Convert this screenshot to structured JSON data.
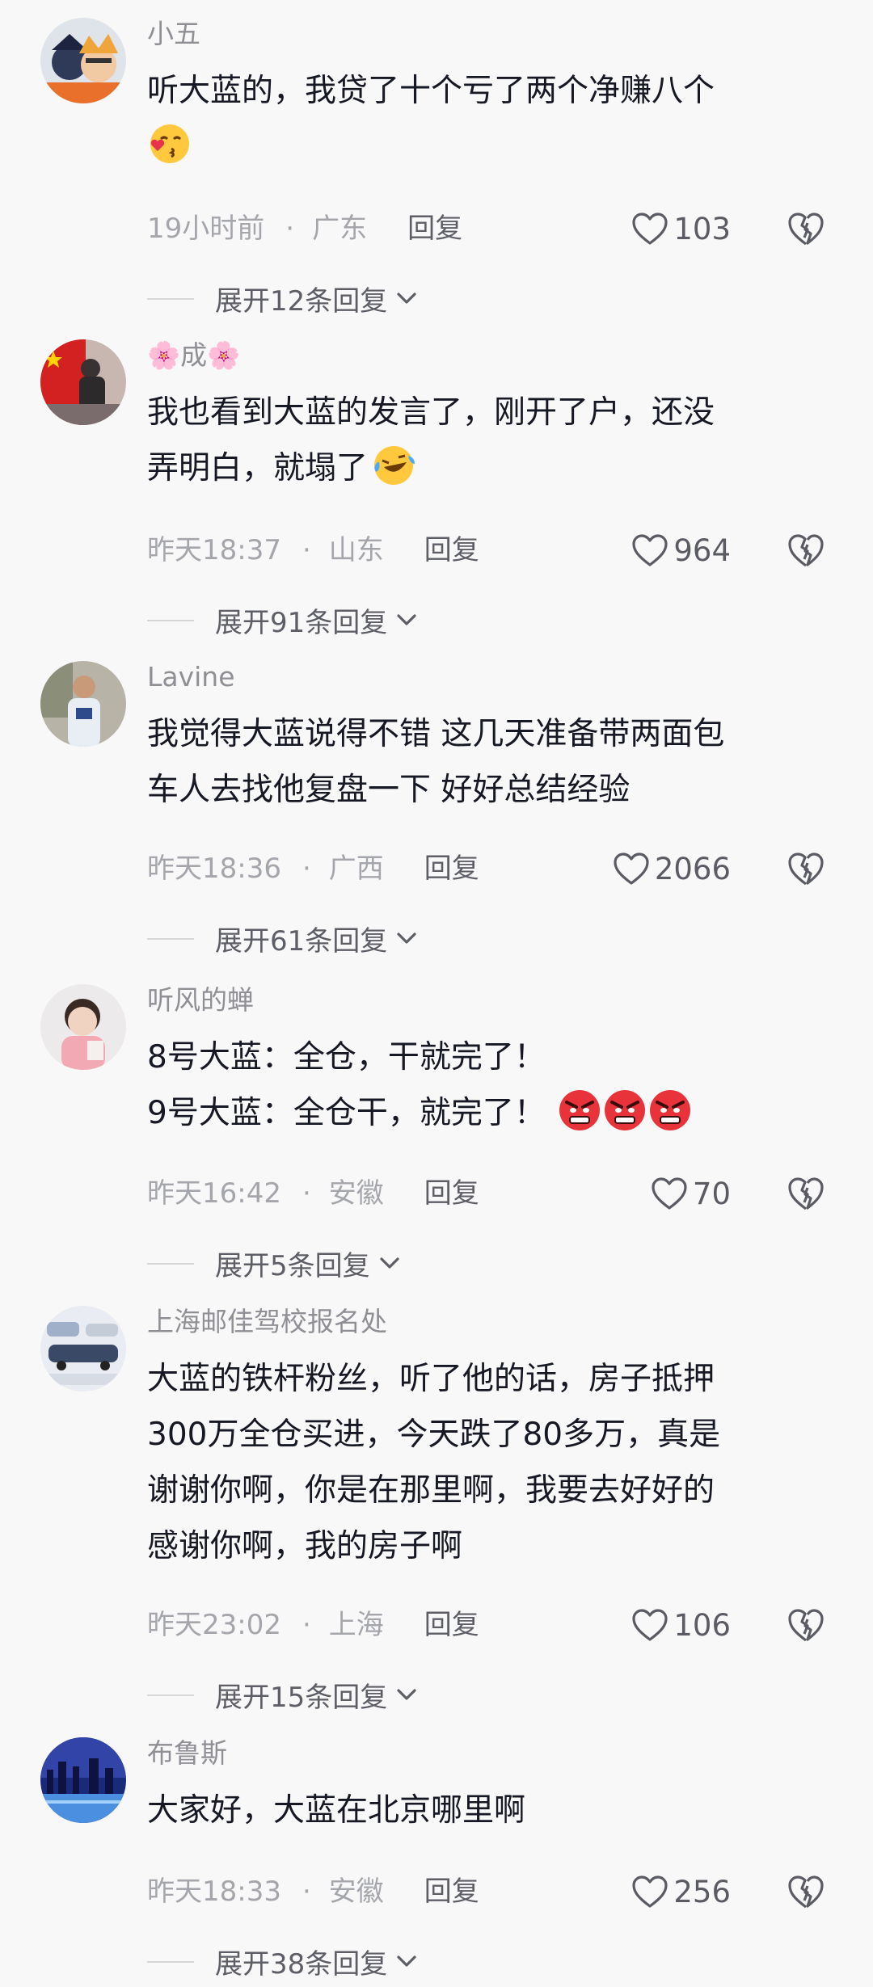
{
  "comments": [
    {
      "username": "小五",
      "lines": [
        "听大蓝的，我贷了十个亏了两个净赚八个",
        ""
      ],
      "emojis": [
        "kiss-face-emoji"
      ],
      "time": "19小时前",
      "location": "广东",
      "reply": "回复",
      "likes": "103",
      "expand": "展开12条回复"
    },
    {
      "username": "🌸成🌸",
      "lines": [
        "我也看到大蓝的发言了，刚开了户，还没",
        "弄明白，就塌了"
      ],
      "emojis": [
        "laugh-cry-emoji"
      ],
      "time": "昨天18:37",
      "location": "山东",
      "reply": "回复",
      "likes": "964",
      "expand": "展开91条回复"
    },
    {
      "username": "Lavine",
      "lines": [
        "我觉得大蓝说得不错 这几天准备带两面包",
        "车人去找他复盘一下 好好总结经验"
      ],
      "emojis": [],
      "time": "昨天18:36",
      "location": "广西",
      "reply": "回复",
      "likes": "2066",
      "expand": "展开61条回复"
    },
    {
      "username": "听风的蝉",
      "lines": [
        "8号大蓝：全仓，干就完了！",
        "9号大蓝：全仓干，就完了！"
      ],
      "emojis": [
        "angry-face-emoji",
        "angry-face-emoji",
        "angry-face-emoji"
      ],
      "time": "昨天16:42",
      "location": "安徽",
      "reply": "回复",
      "likes": "70",
      "expand": "展开5条回复"
    },
    {
      "username": "上海邮佳驾校报名处",
      "lines": [
        "大蓝的铁杆粉丝，听了他的话，房子抵押",
        "300万全仓买进，今天跌了80多万，真是",
        "谢谢你啊，你是在那里啊，我要去好好的",
        "感谢你啊，我的房子啊"
      ],
      "emojis": [],
      "time": "昨天23:02",
      "location": "上海",
      "reply": "回复",
      "likes": "106",
      "expand": "展开15条回复"
    },
    {
      "username": "布鲁斯",
      "lines": [
        "大家好，大蓝在北京哪里啊"
      ],
      "emojis": [],
      "time": "昨天18:33",
      "location": "安徽",
      "reply": "回复",
      "likes": "256",
      "expand": "展开38条回复"
    }
  ],
  "dot": "·"
}
